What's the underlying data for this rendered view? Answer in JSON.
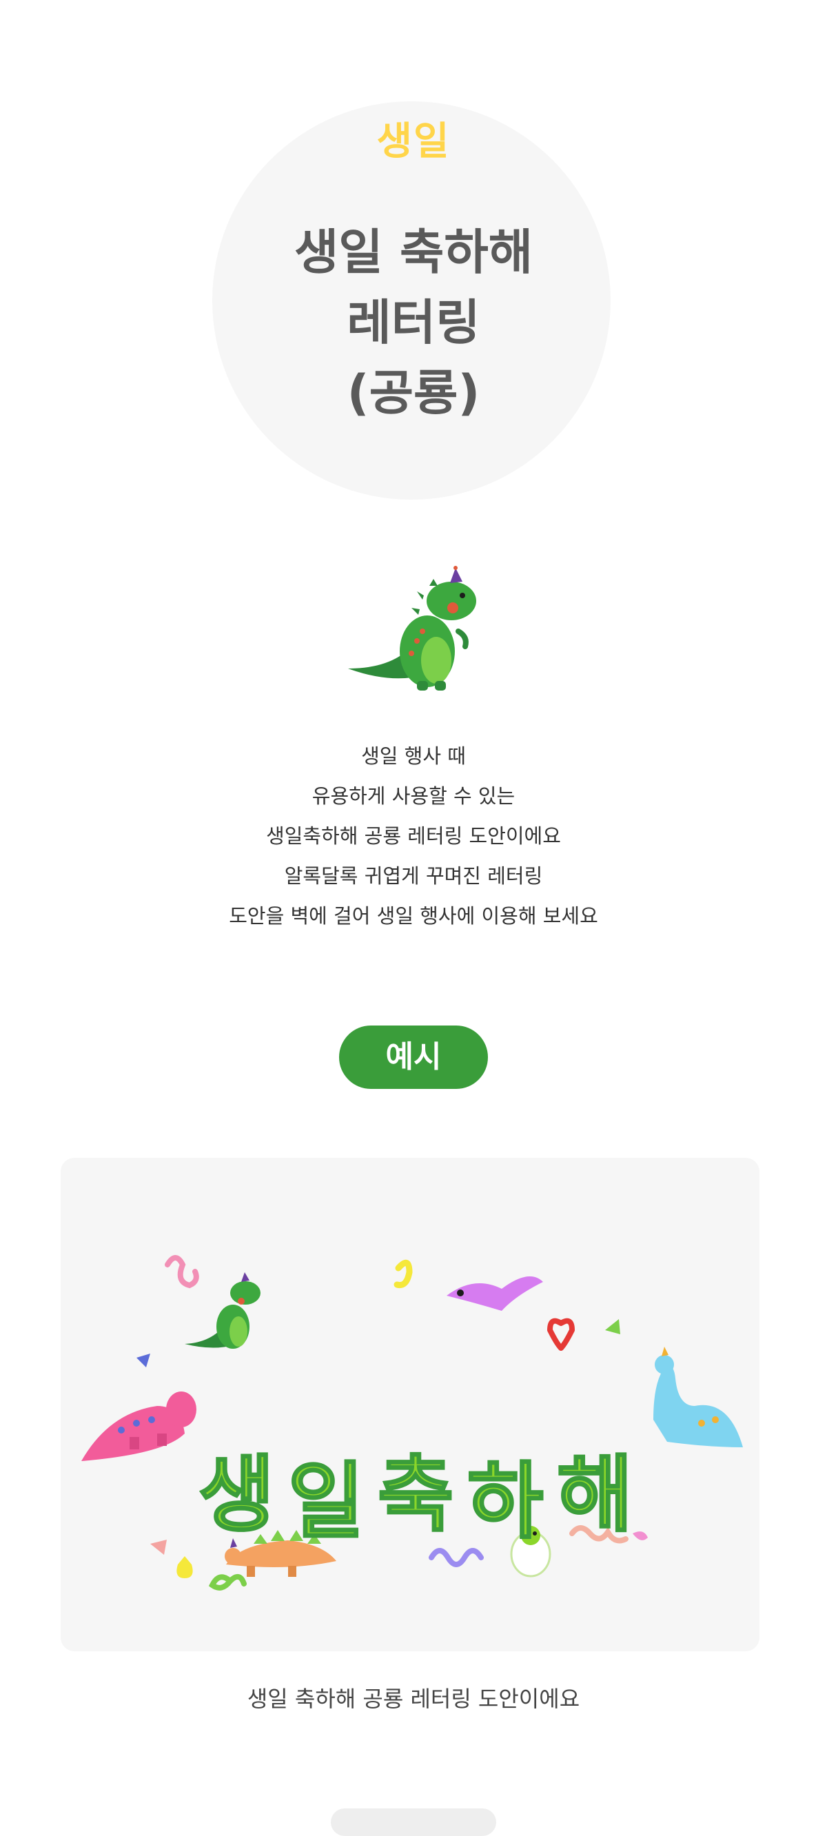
{
  "header": {
    "category": "생일",
    "title_lines": [
      "생일 축하해",
      "레터링",
      "(공룡)"
    ]
  },
  "description": {
    "lines": [
      "생일 행사 때",
      "유용하게 사용할 수 있는",
      "생일축하해 공룡 레터링 도안이에요",
      "알록달록 귀엽게 꾸며진 레터링",
      "도안을 벽에 걸어 생일 행사에 이용해 보세요"
    ]
  },
  "example": {
    "label": "예시",
    "lettering": [
      "생",
      "일",
      "축",
      "하",
      "해"
    ],
    "caption": "생일 축하해 공룡 레터링 도안이에요"
  },
  "colors": {
    "category": "#ffd54a",
    "title": "#5a5a5a",
    "accent_green": "#3a9d3a",
    "lettering_green": "#8bd62a",
    "card_bg": "#f6f6f6"
  },
  "icons": {
    "mascot": "green-dinosaur-party-hat-icon"
  }
}
